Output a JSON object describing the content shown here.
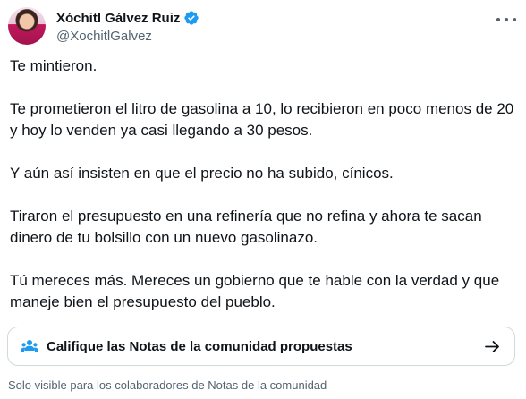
{
  "author": {
    "name": "Xóchitl Gálvez Ruiz",
    "handle": "@XochitlGalvez",
    "verified_icon": "verified-badge-icon",
    "verified_color": "#1d9bf0"
  },
  "tweet": {
    "paragraphs": [
      "Te mintieron.",
      "Te prometieron el litro de gasolina a 10, lo recibieron en poco menos de 20 y hoy lo venden ya casi llegando a 30 pesos.",
      "Y aún así insisten en que el precio no ha subido, cínicos.",
      "Tiraron el presupuesto en una refinería que no refina y ahora te sacan dinero de tu bolsillo con un nuevo gasolinazo.",
      "Tú mereces más. Mereces un gobierno que te hable con la verdad y que maneje bien el presupuesto del pueblo."
    ]
  },
  "community_notes": {
    "button_label": "Califique las Notas de la comunidad propuestas",
    "icon": "people-icon",
    "icon_color": "#1d9bf0",
    "visibility_text": "Solo visible para los colaboradores de Notas de la comunidad"
  },
  "colors": {
    "text_primary": "#0f1419",
    "text_secondary": "#536471",
    "border": "#cfd9de"
  }
}
